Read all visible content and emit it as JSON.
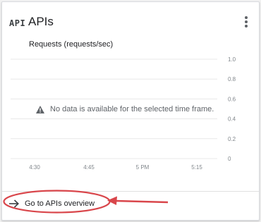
{
  "card": {
    "icon_text": "API",
    "title": "APIs",
    "menu_icon": "more-vert-icon"
  },
  "chart_data": {
    "type": "line",
    "title": "Requests (requests/sec)",
    "x_tick_labels": [
      "4:30",
      "4:45",
      "5 PM",
      "5:15"
    ],
    "y_tick_labels": [
      "1.0",
      "0.8",
      "0.6",
      "0.4",
      "0.2",
      "0"
    ],
    "ylim": [
      0,
      1.0
    ],
    "grid": true,
    "series": [],
    "empty_message": "No data is available for the selected time frame."
  },
  "footer": {
    "link_label": "Go to APIs overview",
    "link_icon": "arrow-right-icon"
  },
  "annotation": {
    "color": "#d9464b"
  },
  "colors": {
    "grid": "#e8e8e8",
    "tick_text": "#80868b"
  }
}
